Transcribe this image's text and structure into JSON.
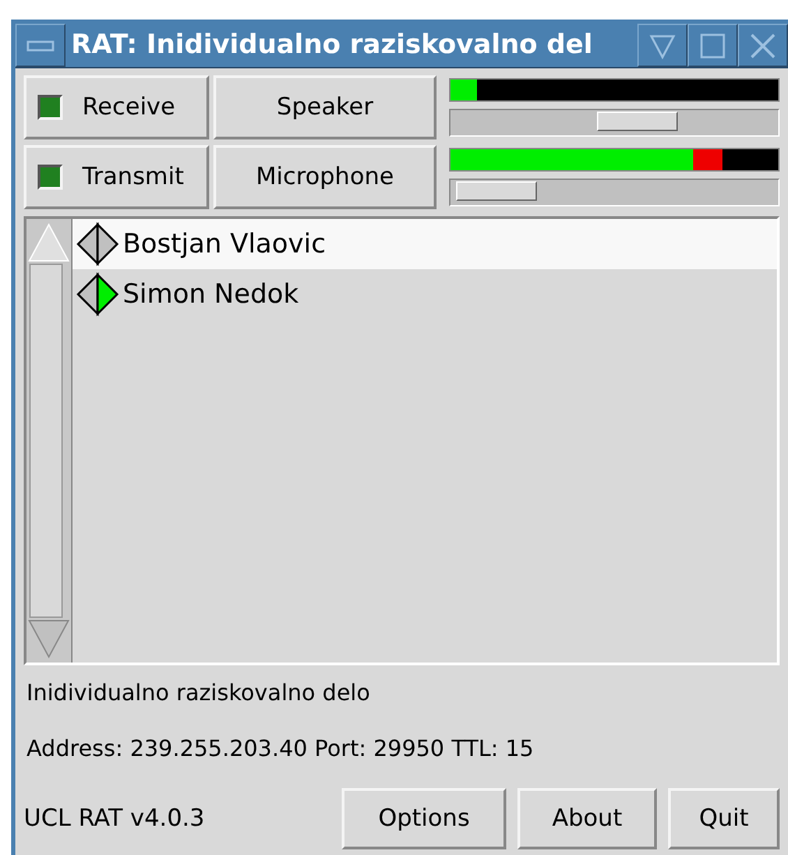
{
  "window": {
    "title": "RAT: Inidividualno raziskovalno del"
  },
  "channels": [
    {
      "toggle": "Receive",
      "on": true,
      "device": "Speaker",
      "meter": {
        "level": 0.08
      },
      "volume": {
        "level": 0.57
      }
    },
    {
      "toggle": "Transmit",
      "on": true,
      "device": "Microphone",
      "meter": {
        "level": 0.83
      },
      "volume": {
        "level": 0.14
      }
    }
  ],
  "participants": [
    {
      "name": "Bostjan Vlaovic",
      "selected": true,
      "talking": false
    },
    {
      "name": "Simon Nedok",
      "selected": false,
      "talking": true
    }
  ],
  "session": {
    "title": "Inidividualno raziskovalno delo",
    "details": "Address: 239.255.203.40 Port: 29950 TTL: 15"
  },
  "footer": {
    "version": "UCL RAT v4.0.3",
    "buttons": [
      "Options",
      "About",
      "Quit"
    ]
  }
}
